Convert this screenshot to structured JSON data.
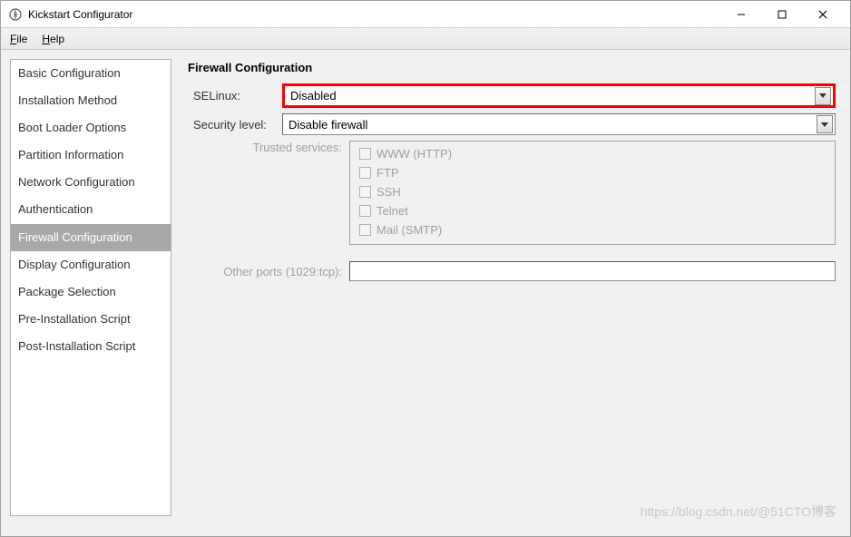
{
  "titlebar": {
    "title": "Kickstart Configurator"
  },
  "menubar": {
    "file": "File",
    "help": "Help"
  },
  "sidebar": {
    "items": [
      {
        "label": "Basic Configuration"
      },
      {
        "label": "Installation Method"
      },
      {
        "label": "Boot Loader Options"
      },
      {
        "label": "Partition Information"
      },
      {
        "label": "Network Configuration"
      },
      {
        "label": "Authentication"
      },
      {
        "label": "Firewall Configuration"
      },
      {
        "label": "Display Configuration"
      },
      {
        "label": "Package Selection"
      },
      {
        "label": "Pre-Installation Script"
      },
      {
        "label": "Post-Installation Script"
      }
    ],
    "selected_index": 6
  },
  "main": {
    "title": "Firewall Configuration",
    "selinux_label": "SELinux:",
    "selinux_value": "Disabled",
    "security_level_label": "Security level:",
    "security_level_value": "Disable firewall",
    "trusted_services_label": "Trusted services:",
    "services": [
      {
        "label": "WWW (HTTP)"
      },
      {
        "label": "FTP"
      },
      {
        "label": "SSH"
      },
      {
        "label": "Telnet"
      },
      {
        "label": "Mail (SMTP)"
      }
    ],
    "other_ports_label": "Other ports (1029:tcp):"
  },
  "watermark": "https://blog.csdn.net/@51CTO博客"
}
